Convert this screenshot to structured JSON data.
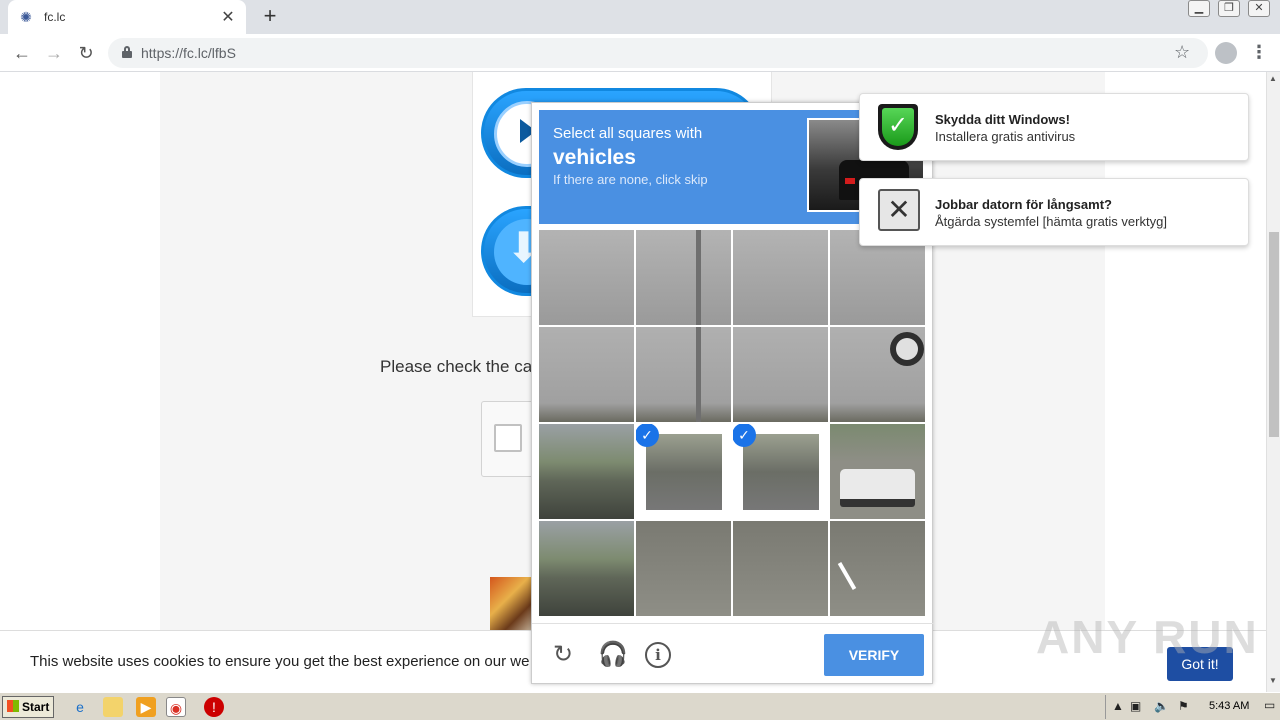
{
  "browser": {
    "tab_title": "fc.lc",
    "url": "https://fc.lc/lfbS",
    "new_tab": "+",
    "tab_close": "✕"
  },
  "page": {
    "check_text": "Please check the ca",
    "cookie_text": "This website uses cookies to ensure you get the best experience on our we",
    "cookie_button": "Got it!",
    "watermark": "ANY RUN"
  },
  "challenge": {
    "line1": "Select all squares with",
    "keyword": "vehicles",
    "line3": "If there are none, click skip",
    "verify_label": "VERIFY",
    "tiles": [
      {
        "kind": "sky",
        "selected": false
      },
      {
        "kind": "sky-pole",
        "selected": false
      },
      {
        "kind": "sky",
        "selected": false
      },
      {
        "kind": "sky",
        "selected": false
      },
      {
        "kind": "road-top",
        "selected": false
      },
      {
        "kind": "road-top-pole",
        "selected": false
      },
      {
        "kind": "road-top",
        "selected": false
      },
      {
        "kind": "road-top-sign",
        "selected": false
      },
      {
        "kind": "bridge",
        "selected": false
      },
      {
        "kind": "bridge",
        "selected": true
      },
      {
        "kind": "road",
        "selected": true
      },
      {
        "kind": "truck",
        "selected": false
      },
      {
        "kind": "bridge",
        "selected": false
      },
      {
        "kind": "road",
        "selected": false
      },
      {
        "kind": "road",
        "selected": false
      },
      {
        "kind": "road-lane",
        "selected": false
      }
    ]
  },
  "notifications": [
    {
      "title": "Skydda ditt Windows!",
      "subtitle": "Installera gratis antivirus",
      "icon": "shield-check-icon"
    },
    {
      "title": "Jobbar datorn för långsamt?",
      "subtitle": "Åtgärda systemfel [hämta gratis verktyg]",
      "icon": "tools-icon"
    }
  ],
  "taskbar": {
    "start_label": "Start",
    "clock": "5:43 AM"
  },
  "colors": {
    "captcha_blue": "#4a90e2",
    "cookie_button": "#1e4ea3",
    "tab_bar": "#dee1e6"
  }
}
